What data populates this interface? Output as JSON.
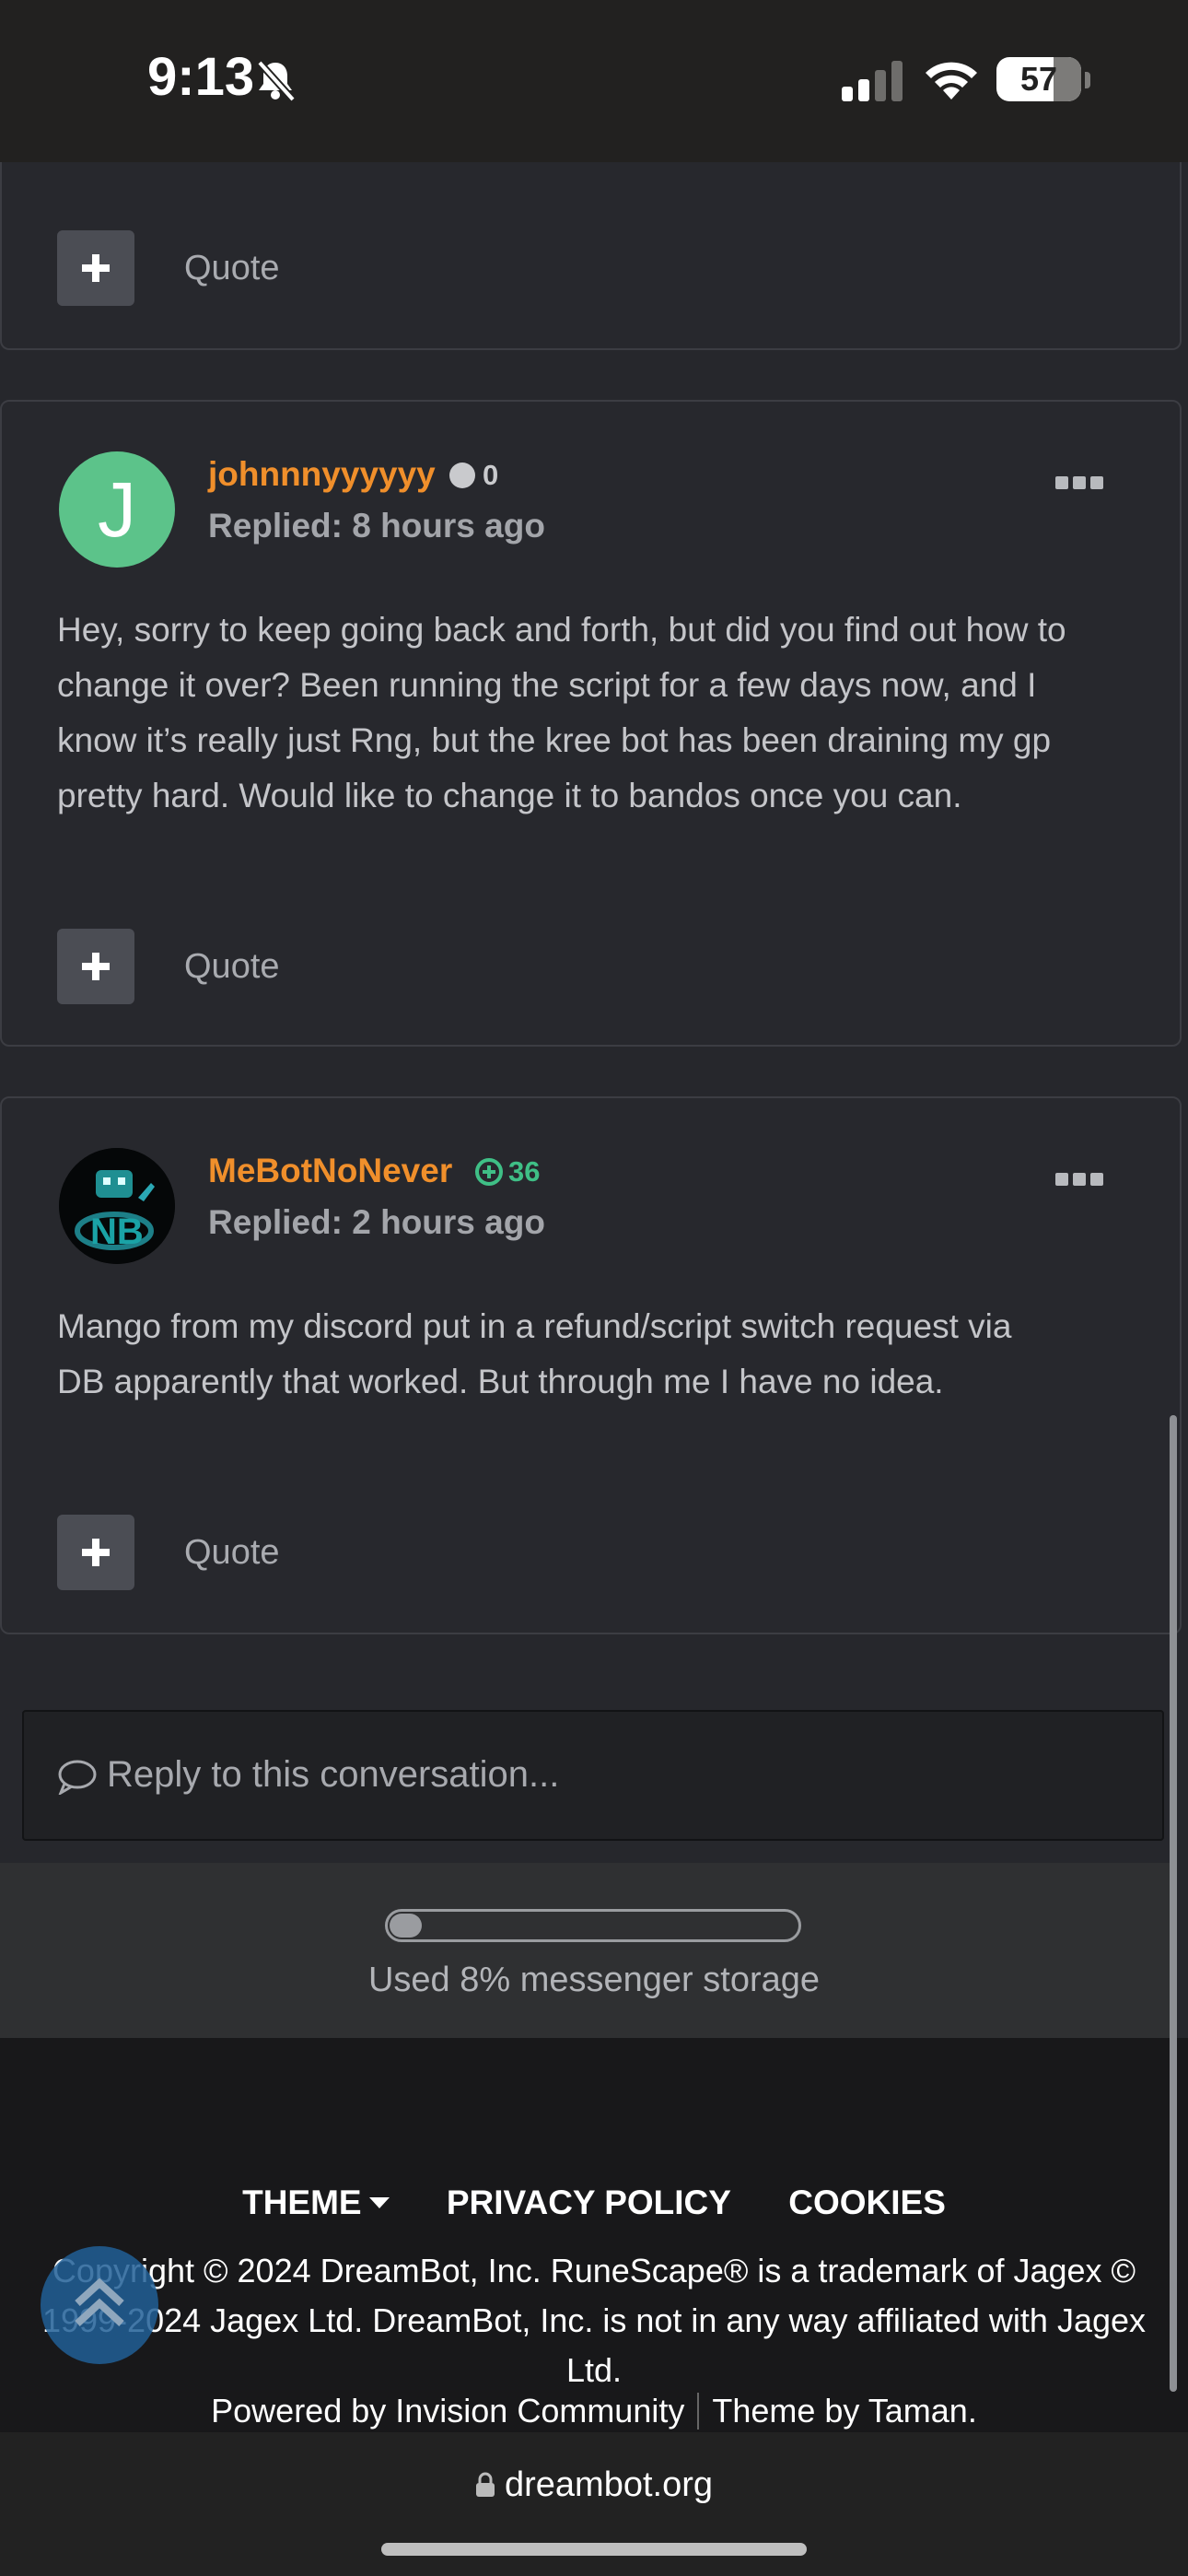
{
  "status": {
    "time": "9:13",
    "battery": "57"
  },
  "posts": [
    {
      "quote_label": "Quote"
    },
    {
      "avatar_letter": "J",
      "author": "johnnnyyyyyy",
      "reputation": "0",
      "replied": "Replied: 8 hours ago",
      "body": [
        "Hey, sorry to keep going back and forth, but did you find out how to",
        "change it over? Been running the script for a few days now, and I",
        "know it’s really just Rng, but the kree bot has been draining my gp",
        "pretty hard. Would like to change it to bandos once you can."
      ],
      "quote_label": "Quote"
    },
    {
      "author": "MeBotNoNever",
      "reputation": "36",
      "replied": "Replied: 2 hours ago",
      "body": [
        "Mango from my discord put in a refund/script switch request via",
        "DB apparently that worked. But through me I have no idea."
      ],
      "quote_label": "Quote"
    }
  ],
  "reply": {
    "placeholder": "Reply to this conversation..."
  },
  "storage": {
    "percent": 8,
    "label": "Used 8% messenger storage"
  },
  "footer": {
    "links": [
      "THEME",
      "PRIVACY POLICY",
      "COOKIES"
    ],
    "copyright": "Copyright © 2024 DreamBot, Inc. RuneScape® is a trademark of Jagex © 1999-2024 Jagex Ltd. DreamBot, Inc. is not in any way affiliated with Jagex Ltd.",
    "powered": "Powered by Invision Community",
    "theme_by": "Theme by Taman."
  },
  "browser": {
    "url": "dreambot.org"
  },
  "colors": {
    "accent": "#f08f2b",
    "positive": "#3fbf86",
    "bg": "#26272c"
  }
}
